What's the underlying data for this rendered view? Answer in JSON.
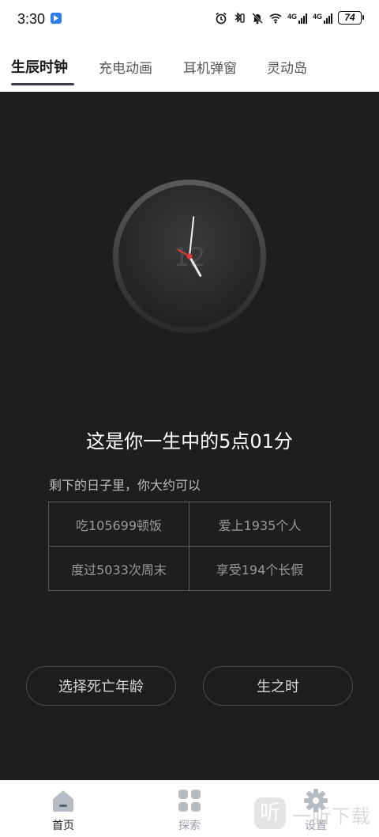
{
  "status_bar": {
    "time": "3:30",
    "battery": "74",
    "signal1_label": "4G",
    "signal2_label": "4G",
    "wifi_label": "6"
  },
  "tabs": [
    {
      "label": "生辰时钟",
      "active": true
    },
    {
      "label": "充电动画",
      "active": false
    },
    {
      "label": "耳机弹窗",
      "active": false
    },
    {
      "label": "灵动岛",
      "active": false
    }
  ],
  "clock": {
    "face_text": "12",
    "hour": 5,
    "minute": 1,
    "second": 0
  },
  "main": {
    "headline": "这是你一生中的5点01分",
    "subtitle": "剩下的日子里，你大约可以",
    "stats": [
      "吃105699顿饭",
      "爱上1935个人",
      "度过5033次周末",
      "享受194个长假"
    ],
    "choose_age_button": "选择死亡年龄",
    "birth_time_button": "生之时"
  },
  "bottom_nav": [
    {
      "label": "首页",
      "icon": "home-icon",
      "active": true
    },
    {
      "label": "探索",
      "icon": "grid-icon",
      "active": false
    },
    {
      "label": "设置",
      "icon": "gear-icon",
      "active": false
    }
  ],
  "watermark": {
    "badge": "听",
    "text": "一听下载"
  },
  "colors": {
    "background_dark": "#1e1e1e",
    "tab_underline": "#3a3f4a",
    "nav_inactive": "#b7bcc4",
    "second_hand": "#e53935"
  }
}
